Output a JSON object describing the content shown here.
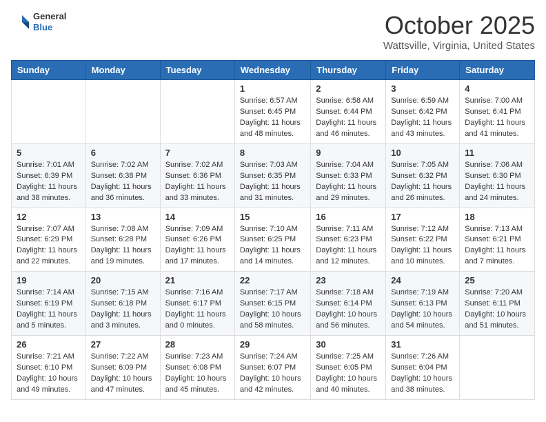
{
  "header": {
    "logo": {
      "general": "General",
      "blue": "Blue"
    },
    "title": "October 2025",
    "location": "Wattsville, Virginia, United States"
  },
  "days_of_week": [
    "Sunday",
    "Monday",
    "Tuesday",
    "Wednesday",
    "Thursday",
    "Friday",
    "Saturday"
  ],
  "weeks": [
    [
      null,
      null,
      null,
      {
        "day": 1,
        "sunrise": "6:57 AM",
        "sunset": "6:45 PM",
        "daylight": "11 hours and 48 minutes."
      },
      {
        "day": 2,
        "sunrise": "6:58 AM",
        "sunset": "6:44 PM",
        "daylight": "11 hours and 46 minutes."
      },
      {
        "day": 3,
        "sunrise": "6:59 AM",
        "sunset": "6:42 PM",
        "daylight": "11 hours and 43 minutes."
      },
      {
        "day": 4,
        "sunrise": "7:00 AM",
        "sunset": "6:41 PM",
        "daylight": "11 hours and 41 minutes."
      }
    ],
    [
      {
        "day": 5,
        "sunrise": "7:01 AM",
        "sunset": "6:39 PM",
        "daylight": "11 hours and 38 minutes."
      },
      {
        "day": 6,
        "sunrise": "7:02 AM",
        "sunset": "6:38 PM",
        "daylight": "11 hours and 36 minutes."
      },
      {
        "day": 7,
        "sunrise": "7:02 AM",
        "sunset": "6:36 PM",
        "daylight": "11 hours and 33 minutes."
      },
      {
        "day": 8,
        "sunrise": "7:03 AM",
        "sunset": "6:35 PM",
        "daylight": "11 hours and 31 minutes."
      },
      {
        "day": 9,
        "sunrise": "7:04 AM",
        "sunset": "6:33 PM",
        "daylight": "11 hours and 29 minutes."
      },
      {
        "day": 10,
        "sunrise": "7:05 AM",
        "sunset": "6:32 PM",
        "daylight": "11 hours and 26 minutes."
      },
      {
        "day": 11,
        "sunrise": "7:06 AM",
        "sunset": "6:30 PM",
        "daylight": "11 hours and 24 minutes."
      }
    ],
    [
      {
        "day": 12,
        "sunrise": "7:07 AM",
        "sunset": "6:29 PM",
        "daylight": "11 hours and 22 minutes."
      },
      {
        "day": 13,
        "sunrise": "7:08 AM",
        "sunset": "6:28 PM",
        "daylight": "11 hours and 19 minutes."
      },
      {
        "day": 14,
        "sunrise": "7:09 AM",
        "sunset": "6:26 PM",
        "daylight": "11 hours and 17 minutes."
      },
      {
        "day": 15,
        "sunrise": "7:10 AM",
        "sunset": "6:25 PM",
        "daylight": "11 hours and 14 minutes."
      },
      {
        "day": 16,
        "sunrise": "7:11 AM",
        "sunset": "6:23 PM",
        "daylight": "11 hours and 12 minutes."
      },
      {
        "day": 17,
        "sunrise": "7:12 AM",
        "sunset": "6:22 PM",
        "daylight": "11 hours and 10 minutes."
      },
      {
        "day": 18,
        "sunrise": "7:13 AM",
        "sunset": "6:21 PM",
        "daylight": "11 hours and 7 minutes."
      }
    ],
    [
      {
        "day": 19,
        "sunrise": "7:14 AM",
        "sunset": "6:19 PM",
        "daylight": "11 hours and 5 minutes."
      },
      {
        "day": 20,
        "sunrise": "7:15 AM",
        "sunset": "6:18 PM",
        "daylight": "11 hours and 3 minutes."
      },
      {
        "day": 21,
        "sunrise": "7:16 AM",
        "sunset": "6:17 PM",
        "daylight": "11 hours and 0 minutes."
      },
      {
        "day": 22,
        "sunrise": "7:17 AM",
        "sunset": "6:15 PM",
        "daylight": "10 hours and 58 minutes."
      },
      {
        "day": 23,
        "sunrise": "7:18 AM",
        "sunset": "6:14 PM",
        "daylight": "10 hours and 56 minutes."
      },
      {
        "day": 24,
        "sunrise": "7:19 AM",
        "sunset": "6:13 PM",
        "daylight": "10 hours and 54 minutes."
      },
      {
        "day": 25,
        "sunrise": "7:20 AM",
        "sunset": "6:11 PM",
        "daylight": "10 hours and 51 minutes."
      }
    ],
    [
      {
        "day": 26,
        "sunrise": "7:21 AM",
        "sunset": "6:10 PM",
        "daylight": "10 hours and 49 minutes."
      },
      {
        "day": 27,
        "sunrise": "7:22 AM",
        "sunset": "6:09 PM",
        "daylight": "10 hours and 47 minutes."
      },
      {
        "day": 28,
        "sunrise": "7:23 AM",
        "sunset": "6:08 PM",
        "daylight": "10 hours and 45 minutes."
      },
      {
        "day": 29,
        "sunrise": "7:24 AM",
        "sunset": "6:07 PM",
        "daylight": "10 hours and 42 minutes."
      },
      {
        "day": 30,
        "sunrise": "7:25 AM",
        "sunset": "6:05 PM",
        "daylight": "10 hours and 40 minutes."
      },
      {
        "day": 31,
        "sunrise": "7:26 AM",
        "sunset": "6:04 PM",
        "daylight": "10 hours and 38 minutes."
      },
      null
    ]
  ]
}
